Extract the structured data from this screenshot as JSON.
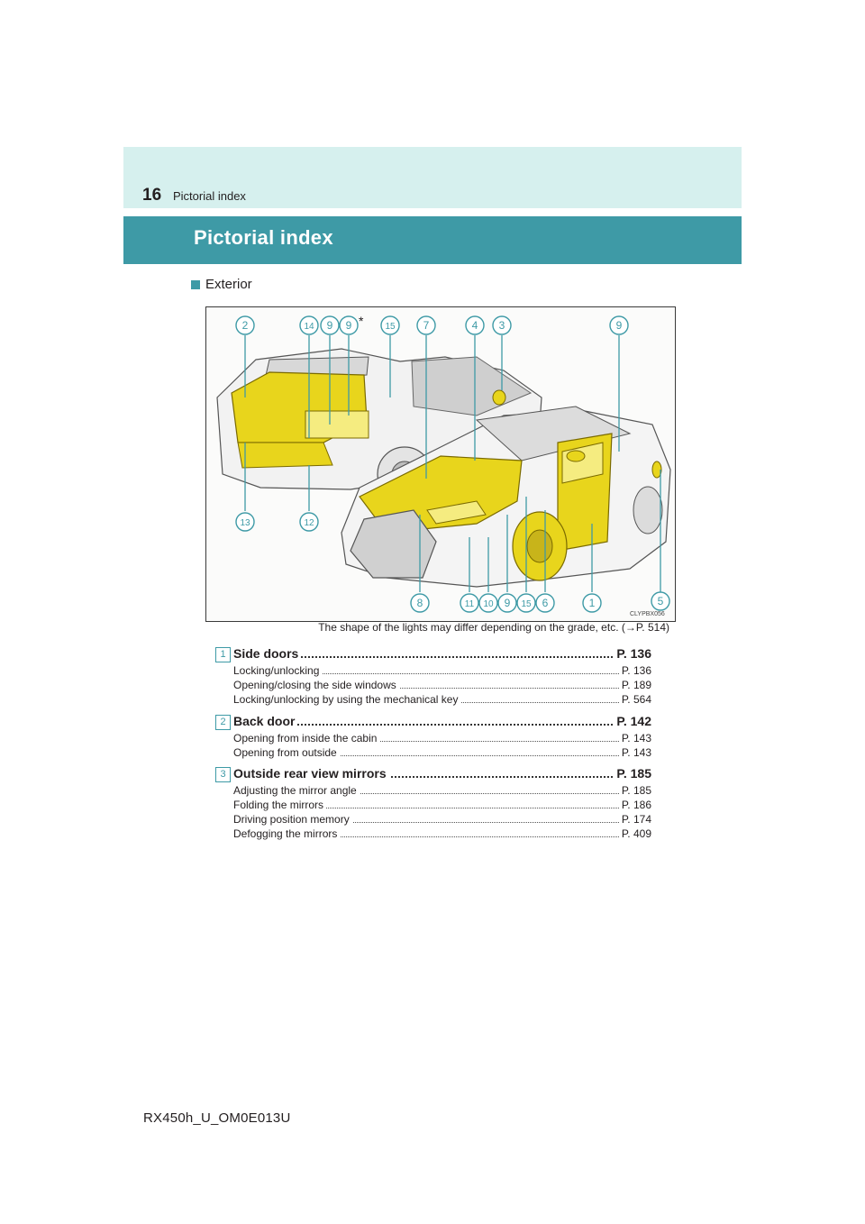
{
  "header": {
    "page_number": "16",
    "running_title": "Pictorial index"
  },
  "section": {
    "title": "Pictorial index"
  },
  "subsection": {
    "label": "Exterior"
  },
  "figure": {
    "callouts": [
      "2",
      "14",
      "9",
      "9",
      "15",
      "7",
      "4",
      "3",
      "9",
      "13",
      "12",
      "8",
      "11",
      "10",
      "9",
      "15",
      "6",
      "1",
      "5"
    ],
    "asterisk": "*",
    "code": "CLYPBX056"
  },
  "caption": "The shape of the lights may differ depending on the grade, etc. (→P. 514)",
  "entries": [
    {
      "num": "1",
      "title": "Side doors",
      "page": "P. 136",
      "subs": [
        {
          "label": "Locking/unlocking",
          "page": "P. 136"
        },
        {
          "label": "Opening/closing the side windows",
          "page": "P. 189"
        },
        {
          "label": "Locking/unlocking by using the mechanical key",
          "page": "P. 564"
        }
      ]
    },
    {
      "num": "2",
      "title": "Back door",
      "page": "P. 142",
      "subs": [
        {
          "label": "Opening from inside the cabin",
          "page": "P. 143"
        },
        {
          "label": "Opening from outside",
          "page": "P. 143"
        }
      ]
    },
    {
      "num": "3",
      "title": "Outside rear view mirrors",
      "page": "P. 185",
      "subs": [
        {
          "label": "Adjusting the mirror angle",
          "page": "P. 185"
        },
        {
          "label": "Folding the mirrors",
          "page": "P. 186"
        },
        {
          "label": "Driving position memory",
          "page": "P. 174"
        },
        {
          "label": "Defogging the mirrors",
          "page": "P. 409"
        }
      ]
    }
  ],
  "footer": {
    "doc_code": "RX450h_U_OM0E013U"
  },
  "colors": {
    "accent": "#3e9aa6",
    "band": "#d6f0ee",
    "highlight": "#e8d51c"
  }
}
